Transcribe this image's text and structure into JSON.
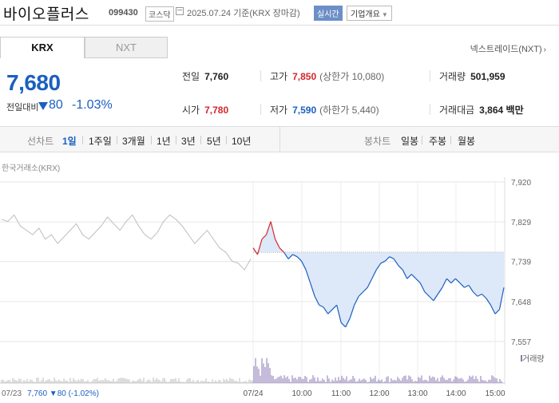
{
  "header": {
    "stock_name": "바이오플러스",
    "stock_code": "099430",
    "market": "코스닥",
    "date_text": "2025.07.24 기준(KRX 장마감)",
    "realtime_button": "실시간",
    "company_info_button": "기업개요"
  },
  "tabs": {
    "krx": "KRX",
    "nxt": "NXT"
  },
  "nextrade_link": "넥스트레이드(NXT)",
  "quote": {
    "price": "7,680",
    "change_label": "전일대비",
    "change_value": "80",
    "change_percent": "-1.03%",
    "prev_close_label": "전일",
    "prev_close": "7,760",
    "high_label": "고가",
    "high": "7,850",
    "upper_limit": "(상한가 10,080)",
    "volume_label": "거래량",
    "volume": "501,959",
    "open_label": "시가",
    "open": "7,780",
    "low_label": "저가",
    "low": "7,590",
    "lower_limit": "(하한가 5,440)",
    "amount_label": "거래대금",
    "amount": "3,864 백만"
  },
  "period_bar": {
    "line_chart_label": "선차트",
    "line_periods": [
      "1일",
      "1주일",
      "3개월",
      "1년",
      "3년",
      "5년",
      "10년"
    ],
    "selected": "1일",
    "candle_label": "봉차트",
    "candle_periods": [
      "일봉",
      "주봉",
      "월봉"
    ]
  },
  "exchange_label": "한국거래소(KRX)",
  "volume_legend": "거래량",
  "bottom_prev_label": "07/23",
  "bottom_prev_value": "7,760 ▼80 (-1.02%)",
  "colors": {
    "up": "#d3262b",
    "down": "#1b5fc1",
    "fill_down": "#dde8f8",
    "fill_up": "#f6c9cb"
  },
  "chart_data": {
    "type": "line",
    "title": "",
    "y_ticks": [
      "7,920",
      "7,829",
      "7,739",
      "7,648",
      "7,557"
    ],
    "ylim": [
      7557,
      7920
    ],
    "baseline": 7760,
    "x_ticks": [
      "07/24",
      "10:00",
      "11:00",
      "12:00",
      "13:00",
      "14:00",
      "15:00"
    ],
    "previous_day": [
      7835,
      7830,
      7845,
      7820,
      7810,
      7800,
      7815,
      7790,
      7800,
      7780,
      7795,
      7810,
      7825,
      7800,
      7790,
      7805,
      7820,
      7840,
      7825,
      7810,
      7830,
      7845,
      7820,
      7800,
      7790,
      7805,
      7830,
      7845,
      7835,
      7820,
      7800,
      7780,
      7795,
      7810,
      7790,
      7770,
      7760,
      7740,
      7735,
      7720,
      7745
    ],
    "today": [
      7770,
      7755,
      7790,
      7800,
      7830,
      7790,
      7770,
      7760,
      7745,
      7755,
      7750,
      7740,
      7720,
      7690,
      7660,
      7640,
      7635,
      7620,
      7630,
      7640,
      7600,
      7590,
      7610,
      7640,
      7660,
      7670,
      7680,
      7700,
      7720,
      7735,
      7740,
      7750,
      7745,
      7730,
      7720,
      7700,
      7710,
      7700,
      7690,
      7670,
      7660,
      7650,
      7665,
      7680,
      7700,
      7690,
      7700,
      7690,
      7680,
      7685,
      7670,
      7660,
      7665,
      7655,
      7640,
      7620,
      7630,
      7680
    ]
  }
}
